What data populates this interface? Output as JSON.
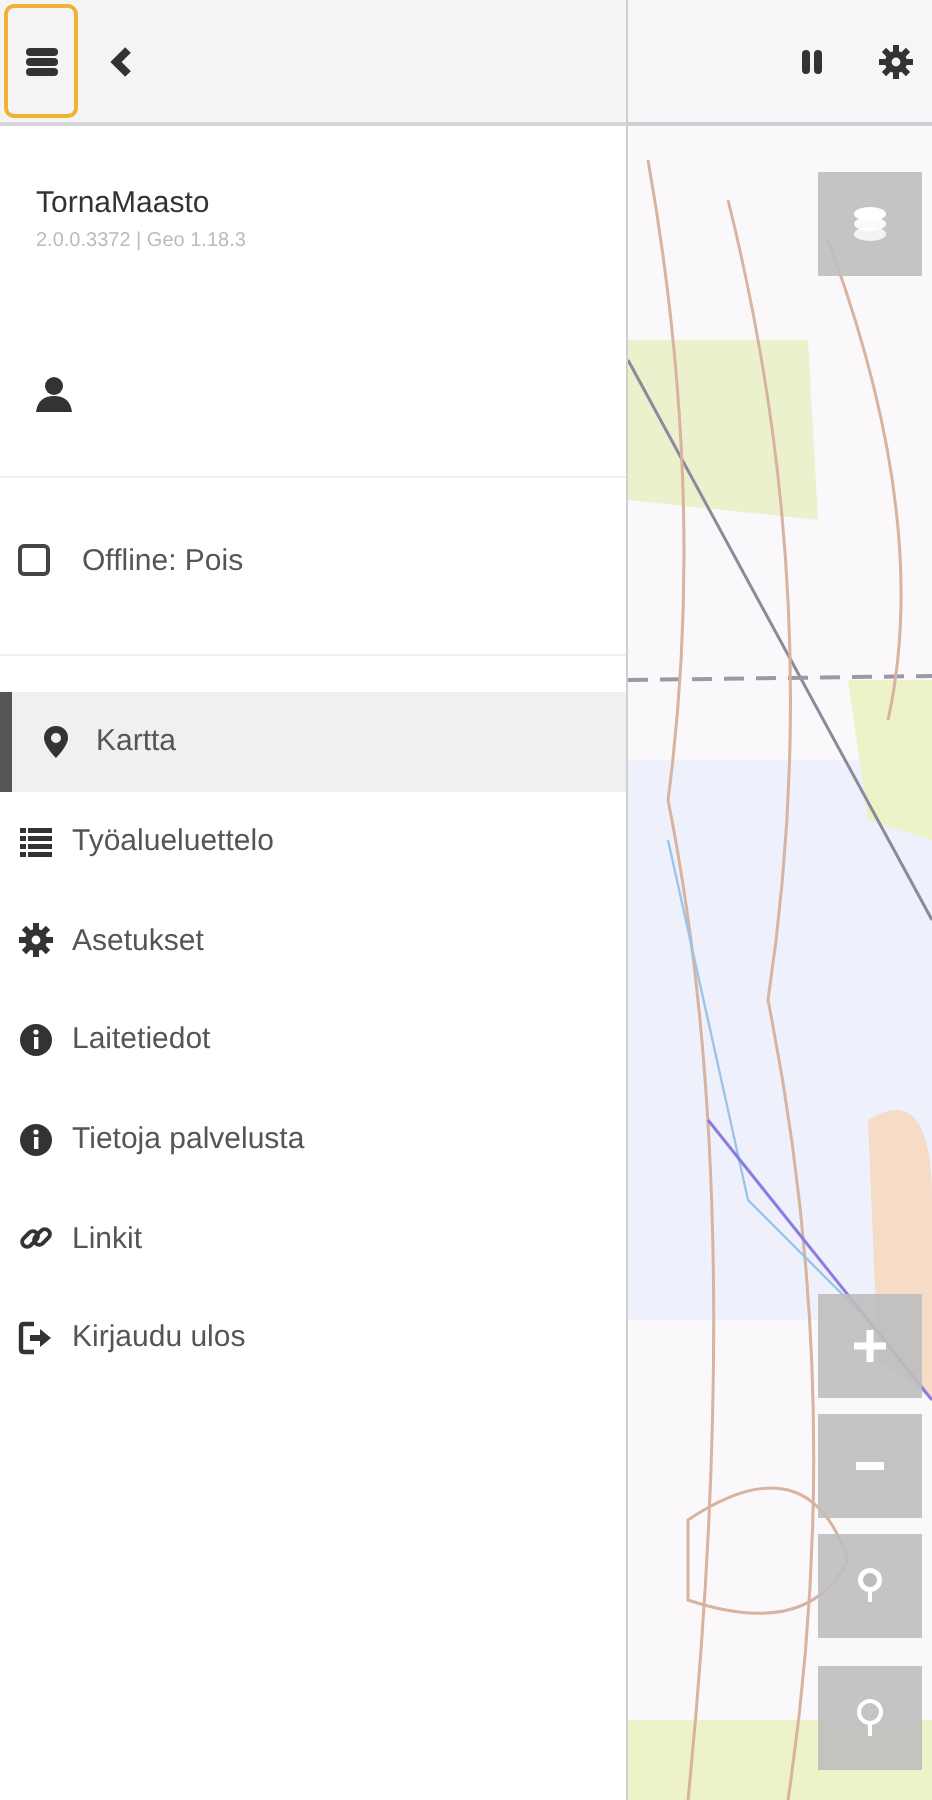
{
  "app": {
    "name": "TornaMaasto",
    "version": "2.0.0.3372 | Geo 1.18.3"
  },
  "offline": {
    "label": "Offline: Pois",
    "checked": false
  },
  "menu": [
    {
      "label": "Kartta",
      "selected": true
    },
    {
      "label": "Työalueluettelo",
      "selected": false
    },
    {
      "label": "Asetukset",
      "selected": false
    },
    {
      "label": "Laitetiedot",
      "selected": false
    },
    {
      "label": "Tietoja palvelusta",
      "selected": false
    },
    {
      "label": "Linkit",
      "selected": false
    },
    {
      "label": "Kirjaudu ulos",
      "selected": false
    }
  ]
}
